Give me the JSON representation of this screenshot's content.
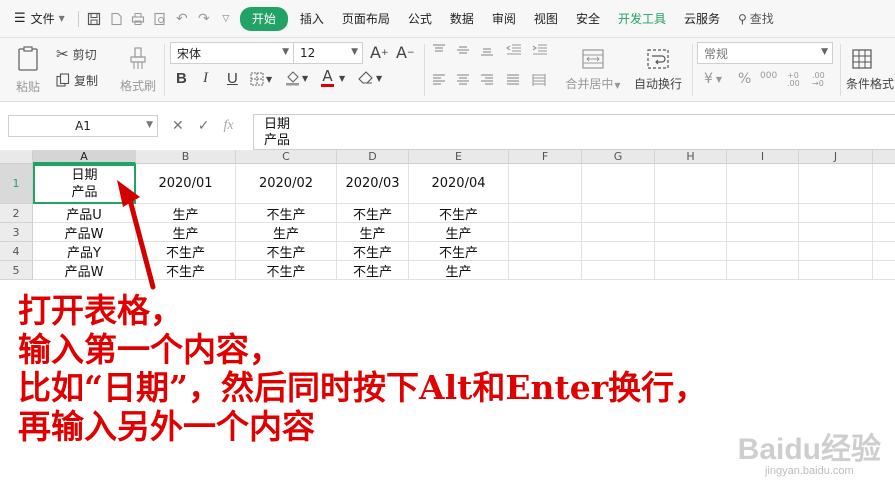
{
  "menubar": {
    "file_label": "文件",
    "tabs": [
      "开始",
      "插入",
      "页面布局",
      "公式",
      "数据",
      "审阅",
      "视图",
      "安全",
      "开发工具",
      "云服务"
    ],
    "active_tab": "开始",
    "search_label": "查找"
  },
  "ribbon": {
    "paste_label": "粘贴",
    "cut_label": "剪切",
    "copy_label": "复制",
    "format_painter_label": "格式刷",
    "font_name": "宋体",
    "font_size": "12",
    "bold": "B",
    "italic": "I",
    "underline": "U",
    "font_color_letter": "A",
    "merge_label": "合并居中",
    "wrap_label": "自动换行",
    "number_format": "常规",
    "currency_symbol": "¥",
    "percent_symbol": "%",
    "conditional_format_label": "条件格式"
  },
  "formula_bar": {
    "name_box": "A1",
    "fx_label": "fx",
    "content_line1": "日期",
    "content_line2": "产品"
  },
  "sheet": {
    "columns": [
      "A",
      "B",
      "C",
      "D",
      "E",
      "F",
      "G",
      "H",
      "I",
      "J"
    ],
    "rows": [
      "1",
      "2",
      "3",
      "4",
      "5"
    ],
    "cells": {
      "A1_line1": "日期",
      "A1_line2": "产品",
      "B1": "2020/01",
      "C1": "2020/02",
      "D1": "2020/03",
      "E1": "2020/04",
      "A2": "产品U",
      "B2": "生产",
      "C2": "不生产",
      "D2": "不生产",
      "E2": "不生产",
      "A3": "产品W",
      "B3": "生产",
      "C3": "生产",
      "D3": "生产",
      "E3": "生产",
      "A4": "产品Y",
      "B4": "不生产",
      "C4": "不生产",
      "D4": "不生产",
      "E4": "不生产",
      "A5": "产品W",
      "B5": "不生产",
      "C5": "不生产",
      "D5": "不生产",
      "E5": "生产"
    }
  },
  "annotation": {
    "line1": "打开表格，",
    "line2": "输入第一个内容，",
    "line3": "比如“日期”，然后同时按下Alt和Enter换行，",
    "line4": "再输入另外一个内容",
    "color": "#e00000"
  },
  "watermark": {
    "brand": "Baidu经验",
    "url": "jingyan.baidu.com"
  },
  "colors": {
    "accent": "#21a366",
    "annotation_red": "#e00000"
  }
}
